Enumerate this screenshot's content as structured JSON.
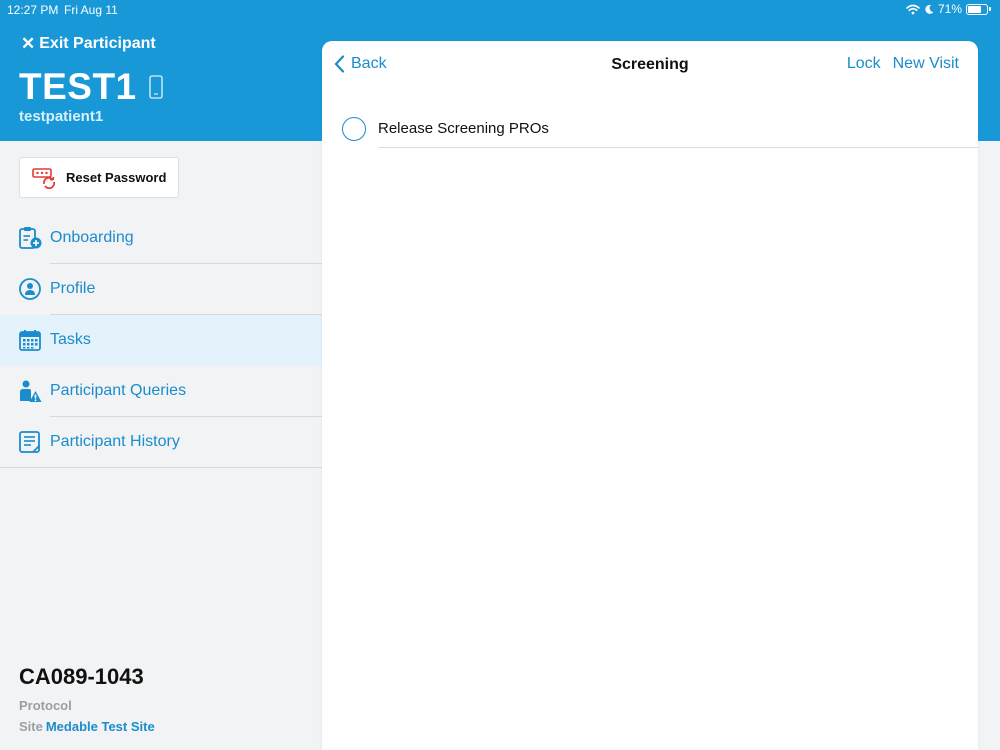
{
  "status_bar": {
    "time": "12:27 PM",
    "date": "Fri Aug 11",
    "battery": "71%",
    "battery_level": 0.71
  },
  "header": {
    "exit_label": "Exit Participant",
    "participant_id": "TEST1",
    "username": "testpatient1"
  },
  "reset_button": {
    "label": "Reset Password"
  },
  "menu": [
    {
      "label": "Onboarding",
      "icon": "clipboard-add-icon"
    },
    {
      "label": "Profile",
      "icon": "person-circle-icon"
    },
    {
      "label": "Tasks",
      "icon": "calendar-icon"
    },
    {
      "label": "Participant Queries",
      "icon": "person-warning-icon"
    },
    {
      "label": "Participant History",
      "icon": "history-list-icon"
    }
  ],
  "footer": {
    "study_code": "CA089-1043",
    "protocol_label": "Protocol",
    "site_label": "Site",
    "site_name": "Medable Test Site"
  },
  "panel": {
    "back_label": "Back",
    "title": "Screening",
    "lock_label": "Lock",
    "new_visit_label": "New Visit",
    "tasks": [
      {
        "label": "Release Screening PROs"
      }
    ]
  },
  "colors": {
    "header": "#1998d8",
    "accent": "#1b8ccc",
    "alert": "#e53935"
  }
}
